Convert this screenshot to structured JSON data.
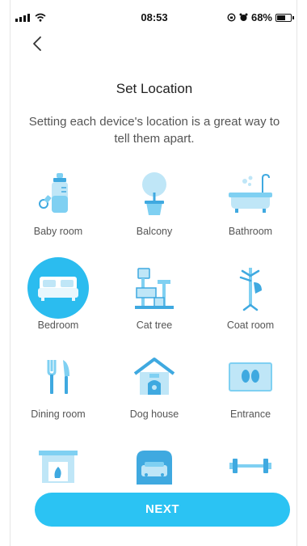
{
  "status_bar": {
    "time": "08:53",
    "battery": "68%",
    "battery_level": 0.68
  },
  "page": {
    "title": "Set Location",
    "subtitle": "Setting each device's location is a great way to tell them apart."
  },
  "locations": [
    {
      "label": "Baby room",
      "icon": "baby-bottle-icon",
      "selected": false
    },
    {
      "label": "Balcony",
      "icon": "potted-tree-icon",
      "selected": false
    },
    {
      "label": "Bathroom",
      "icon": "bathtub-icon",
      "selected": false
    },
    {
      "label": "Bedroom",
      "icon": "bed-icon",
      "selected": true
    },
    {
      "label": "Cat tree",
      "icon": "cat-tree-icon",
      "selected": false
    },
    {
      "label": "Coat room",
      "icon": "coat-rack-icon",
      "selected": false
    },
    {
      "label": "Dining room",
      "icon": "fork-knife-icon",
      "selected": false
    },
    {
      "label": "Dog house",
      "icon": "dog-house-icon",
      "selected": false
    },
    {
      "label": "Entrance",
      "icon": "doormat-icon",
      "selected": false
    },
    {
      "label": "",
      "icon": "fireplace-icon",
      "selected": false
    },
    {
      "label": "",
      "icon": "garage-car-icon",
      "selected": false
    },
    {
      "label": "",
      "icon": "dumbbell-icon",
      "selected": false
    }
  ],
  "colors": {
    "accent": "#2bc3f3",
    "icon_light": "#bfe6f7",
    "icon_mid": "#7fd0f2",
    "icon_dark": "#3fa9e0"
  },
  "next_button": {
    "label": "NEXT"
  }
}
